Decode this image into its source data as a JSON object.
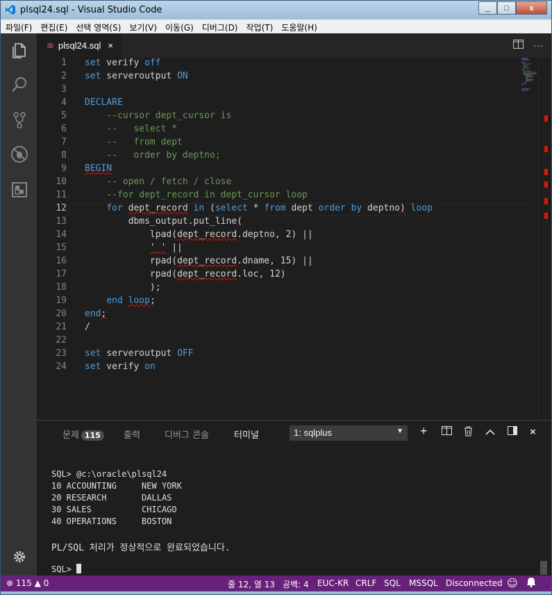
{
  "window": {
    "title": "plsql24.sql - Visual Studio Code",
    "controls": {
      "minimize": "_",
      "maximize": "□",
      "close": "x"
    }
  },
  "menu": [
    "파일(F)",
    "편집(E)",
    "선택 영역(S)",
    "보기(V)",
    "이동(G)",
    "디버그(D)",
    "작업(T)",
    "도움말(H)"
  ],
  "activity_bar": [
    "files-icon",
    "search-icon",
    "source-control-icon",
    "debug-icon",
    "extensions-icon",
    "gear-icon"
  ],
  "editor": {
    "tab": {
      "icon": "database-file-icon",
      "label": "plsql24.sql",
      "close": "×"
    },
    "actions": {
      "split": "split-editor-icon",
      "more": "···"
    },
    "active_line": 12,
    "lines": [
      {
        "n": "1",
        "text": "set verify off"
      },
      {
        "n": "2",
        "text": "set serveroutput ON"
      },
      {
        "n": "3",
        "text": ""
      },
      {
        "n": "4",
        "text": "DECLARE"
      },
      {
        "n": "5",
        "text": "    --cursor dept_cursor is"
      },
      {
        "n": "6",
        "text": "    --   select *"
      },
      {
        "n": "7",
        "text": "    --   from dept"
      },
      {
        "n": "8",
        "text": "    --   order by deptno;"
      },
      {
        "n": "9",
        "text": "BEGIN"
      },
      {
        "n": "10",
        "text": "    -- open / fetch / close"
      },
      {
        "n": "11",
        "text": "    --for dept_record in dept_cursor loop"
      },
      {
        "n": "12",
        "text": "    for dept_record in (select * from dept order by deptno) loop"
      },
      {
        "n": "13",
        "text": "        dbms_output.put_line("
      },
      {
        "n": "14",
        "text": "            lpad(dept_record.deptno, 2) ||"
      },
      {
        "n": "15",
        "text": "            ' ' ||"
      },
      {
        "n": "16",
        "text": "            rpad(dept_record.dname, 15) ||"
      },
      {
        "n": "17",
        "text": "            rpad(dept_record.loc, 12)"
      },
      {
        "n": "18",
        "text": "            );"
      },
      {
        "n": "19",
        "text": "    end loop;"
      },
      {
        "n": "20",
        "text": "end;"
      },
      {
        "n": "21",
        "text": "/"
      },
      {
        "n": "22",
        "text": ""
      },
      {
        "n": "23",
        "text": "set serveroutput OFF"
      },
      {
        "n": "24",
        "text": "set verify on"
      }
    ]
  },
  "panel": {
    "tabs": {
      "problems": "문제",
      "problems_count": "115",
      "output": "출력",
      "debug_console": "디버그 콘솔",
      "terminal": "터미널"
    },
    "terminal_select": "1: sqlplus",
    "actions": {
      "new": "+",
      "split": "split-icon",
      "trash": "trash-icon",
      "maximize": "^",
      "layout": "layout-icon",
      "close": "×"
    },
    "terminal_lines": [
      "SQL> @c:\\oracle\\plsql24",
      "10 ACCOUNTING     NEW YORK",
      "20 RESEARCH       DALLAS",
      "30 SALES          CHICAGO",
      "40 OPERATIONS     BOSTON",
      "",
      "PL/SQL 처리가 정상적으로 완료되었습니다.",
      "",
      "SQL> "
    ]
  },
  "statusbar": {
    "errors": "115",
    "warnings": "0",
    "position": "줄 12, 열 13",
    "spaces": "공백: 4",
    "encoding": "EUC-KR",
    "eol": "CRLF",
    "language": "SQL",
    "connection_type": "MSSQL",
    "connection": "Disconnected"
  },
  "colors": {
    "statusbar": "#68217a",
    "keyword": "#569cd6",
    "comment": "#6a9955",
    "error": "#e51400"
  }
}
